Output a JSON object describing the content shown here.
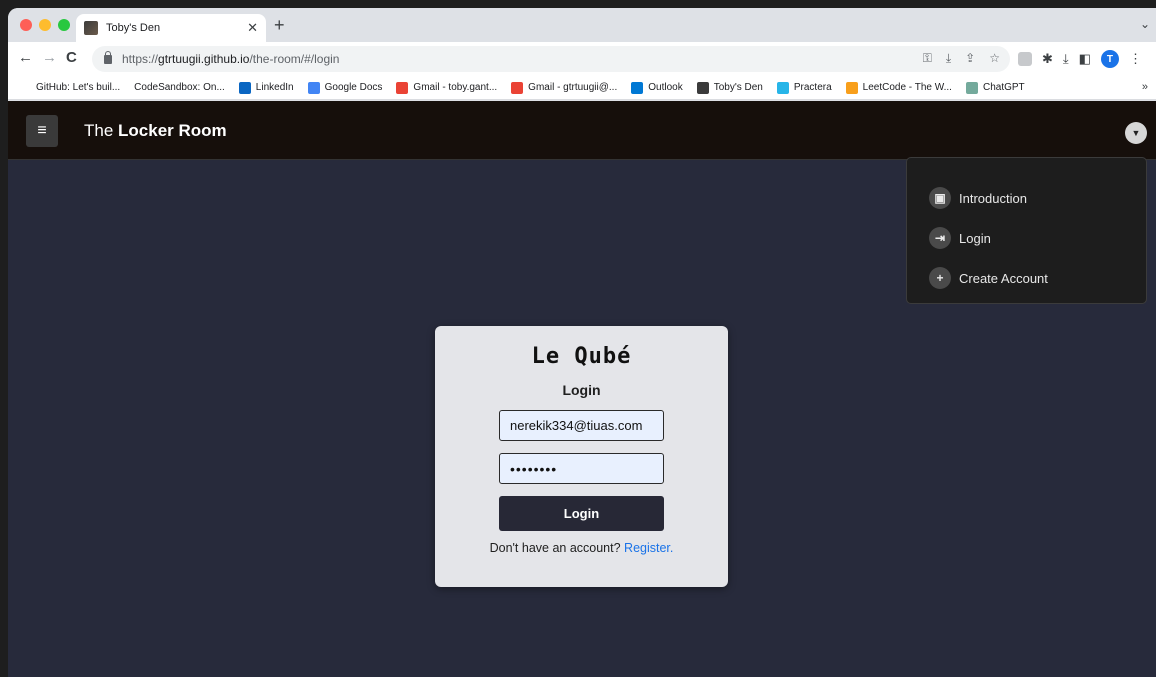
{
  "browser": {
    "tab": {
      "title": "Toby's Den",
      "close": "✕"
    },
    "new_tab": "+",
    "tab_menu": "⌄",
    "nav": {
      "back": "←",
      "forward": "→",
      "reload": "C"
    },
    "url_prefix": "https://",
    "url_domain": "gtrtuugii.github.io",
    "url_path": "/the-room/#/login",
    "omnibox_icons": [
      "key-icon",
      "install-icon",
      "share-icon",
      "star-icon"
    ],
    "profile_initial": "T",
    "bookmarks": [
      {
        "label": "GitHub: Let's buil...",
        "icon": "github-icon",
        "color": "#ffffff"
      },
      {
        "label": "CodeSandbox: On...",
        "icon": "codesandbox-icon",
        "color": "#ffffff"
      },
      {
        "label": "LinkedIn",
        "icon": "linkedin-icon",
        "color": "#0a66c2"
      },
      {
        "label": "Google Docs",
        "icon": "google-docs-icon",
        "color": "#4285f4"
      },
      {
        "label": "Gmail - toby.gant...",
        "icon": "gmail-icon",
        "color": "#ea4335"
      },
      {
        "label": "Gmail - gtrtuugii@...",
        "icon": "gmail-icon",
        "color": "#ea4335"
      },
      {
        "label": "Outlook",
        "icon": "outlook-icon",
        "color": "#0078d4"
      },
      {
        "label": "Toby's Den",
        "icon": "tobys-den-icon",
        "color": "#3b3b3b"
      },
      {
        "label": "Practera",
        "icon": "practera-icon",
        "color": "#27b5e8"
      },
      {
        "label": "LeetCode - The W...",
        "icon": "leetcode-icon",
        "color": "#f89f1b"
      },
      {
        "label": "ChatGPT",
        "icon": "chatgpt-icon",
        "color": "#74aa9c"
      }
    ],
    "bookmarks_more": "»"
  },
  "app": {
    "brand_prefix": "The ",
    "brand_bold": "Locker Room",
    "menu": [
      {
        "label": "Introduction",
        "icon": "profile-icon",
        "glyph": "▣"
      },
      {
        "label": "Login",
        "icon": "login-icon",
        "glyph": "⇥"
      },
      {
        "label": "Create Account",
        "icon": "plus-icon",
        "glyph": "+"
      }
    ]
  },
  "login": {
    "brand": "Le Qubé",
    "title": "Login",
    "email_value": "nerekik334@tiuas.com",
    "password_value": "••••••••",
    "submit_label": "Login",
    "register_prompt": "Don't have an account? ",
    "register_link": "Register."
  }
}
